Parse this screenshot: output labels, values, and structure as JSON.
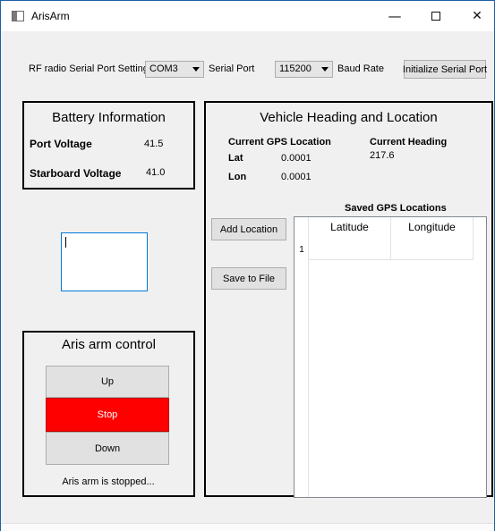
{
  "window": {
    "title": "ArisArm",
    "min_glyph": "—",
    "close_glyph": "✕"
  },
  "serial": {
    "settings_label": "RF radio Serial Port Settings",
    "port_value": "COM3",
    "port_label": "Serial Port",
    "baud_value": "115200",
    "baud_label": "Baud Rate",
    "init_button": "Initialize Serial Port"
  },
  "battery": {
    "title": "Battery Information",
    "port_label": "Port Voltage",
    "port_value": "41.5",
    "starboard_label": "Starboard Voltage",
    "starboard_value": "41.0"
  },
  "vehicle": {
    "title": "Vehicle Heading and Location",
    "gps_heading": "Current GPS Location",
    "heading_heading": "Current Heading",
    "lat_label": "Lat",
    "lat_value": "0.0001",
    "lon_label": "Lon",
    "lon_value": "0.0001",
    "heading_value": "217.6",
    "saved_title": "Saved GPS Locations",
    "add_button": "Add Location",
    "save_button": "Save to File",
    "table": {
      "columns": [
        "Latitude",
        "Longitude"
      ],
      "rows": [
        "1"
      ]
    }
  },
  "arm": {
    "title": "Aris arm control",
    "up": "Up",
    "stop": "Stop",
    "down": "Down",
    "status": "Aris arm is stopped..."
  },
  "colors": {
    "stop_button": "#ff0000",
    "window_border": "#1f5fa8",
    "focus_border": "#0078d7"
  }
}
